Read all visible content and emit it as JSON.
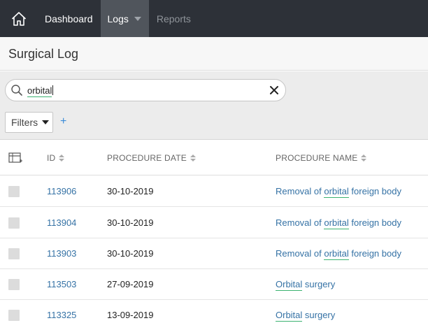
{
  "nav": {
    "items": [
      {
        "label": "Dashboard"
      },
      {
        "label": "Logs"
      },
      {
        "label": "Reports"
      }
    ]
  },
  "page": {
    "title": "Surgical Log"
  },
  "search": {
    "value": "orbital"
  },
  "filters": {
    "label": "Filters",
    "add_label": "+"
  },
  "table": {
    "columns": [
      "ID",
      "PROCEDURE DATE",
      "PROCEDURE NAME"
    ],
    "rows": [
      {
        "id": "113906",
        "date": "30-10-2019",
        "name_pre": "Removal of ",
        "name_term": "orbital",
        "name_post": " foreign body"
      },
      {
        "id": "113904",
        "date": "30-10-2019",
        "name_pre": "Removal of ",
        "name_term": "orbital",
        "name_post": " foreign body"
      },
      {
        "id": "113903",
        "date": "30-10-2019",
        "name_pre": "Removal of ",
        "name_term": "orbital",
        "name_post": " foreign body"
      },
      {
        "id": "113503",
        "date": "27-09-2019",
        "name_pre": "",
        "name_term": "Orbital",
        "name_post": " surgery"
      },
      {
        "id": "113325",
        "date": "13-09-2019",
        "name_pre": "",
        "name_term": "Orbital",
        "name_post": " surgery"
      }
    ]
  },
  "colors": {
    "nav_bg": "#2d3138",
    "nav_active": "#50555c",
    "link": "#3572a5",
    "spell_underline": "#3cb371",
    "add_blue": "#3a8bd8"
  },
  "icons": {
    "home": "home-icon",
    "search": "search-icon",
    "clear": "close-icon",
    "columns": "column-picker-icon"
  }
}
